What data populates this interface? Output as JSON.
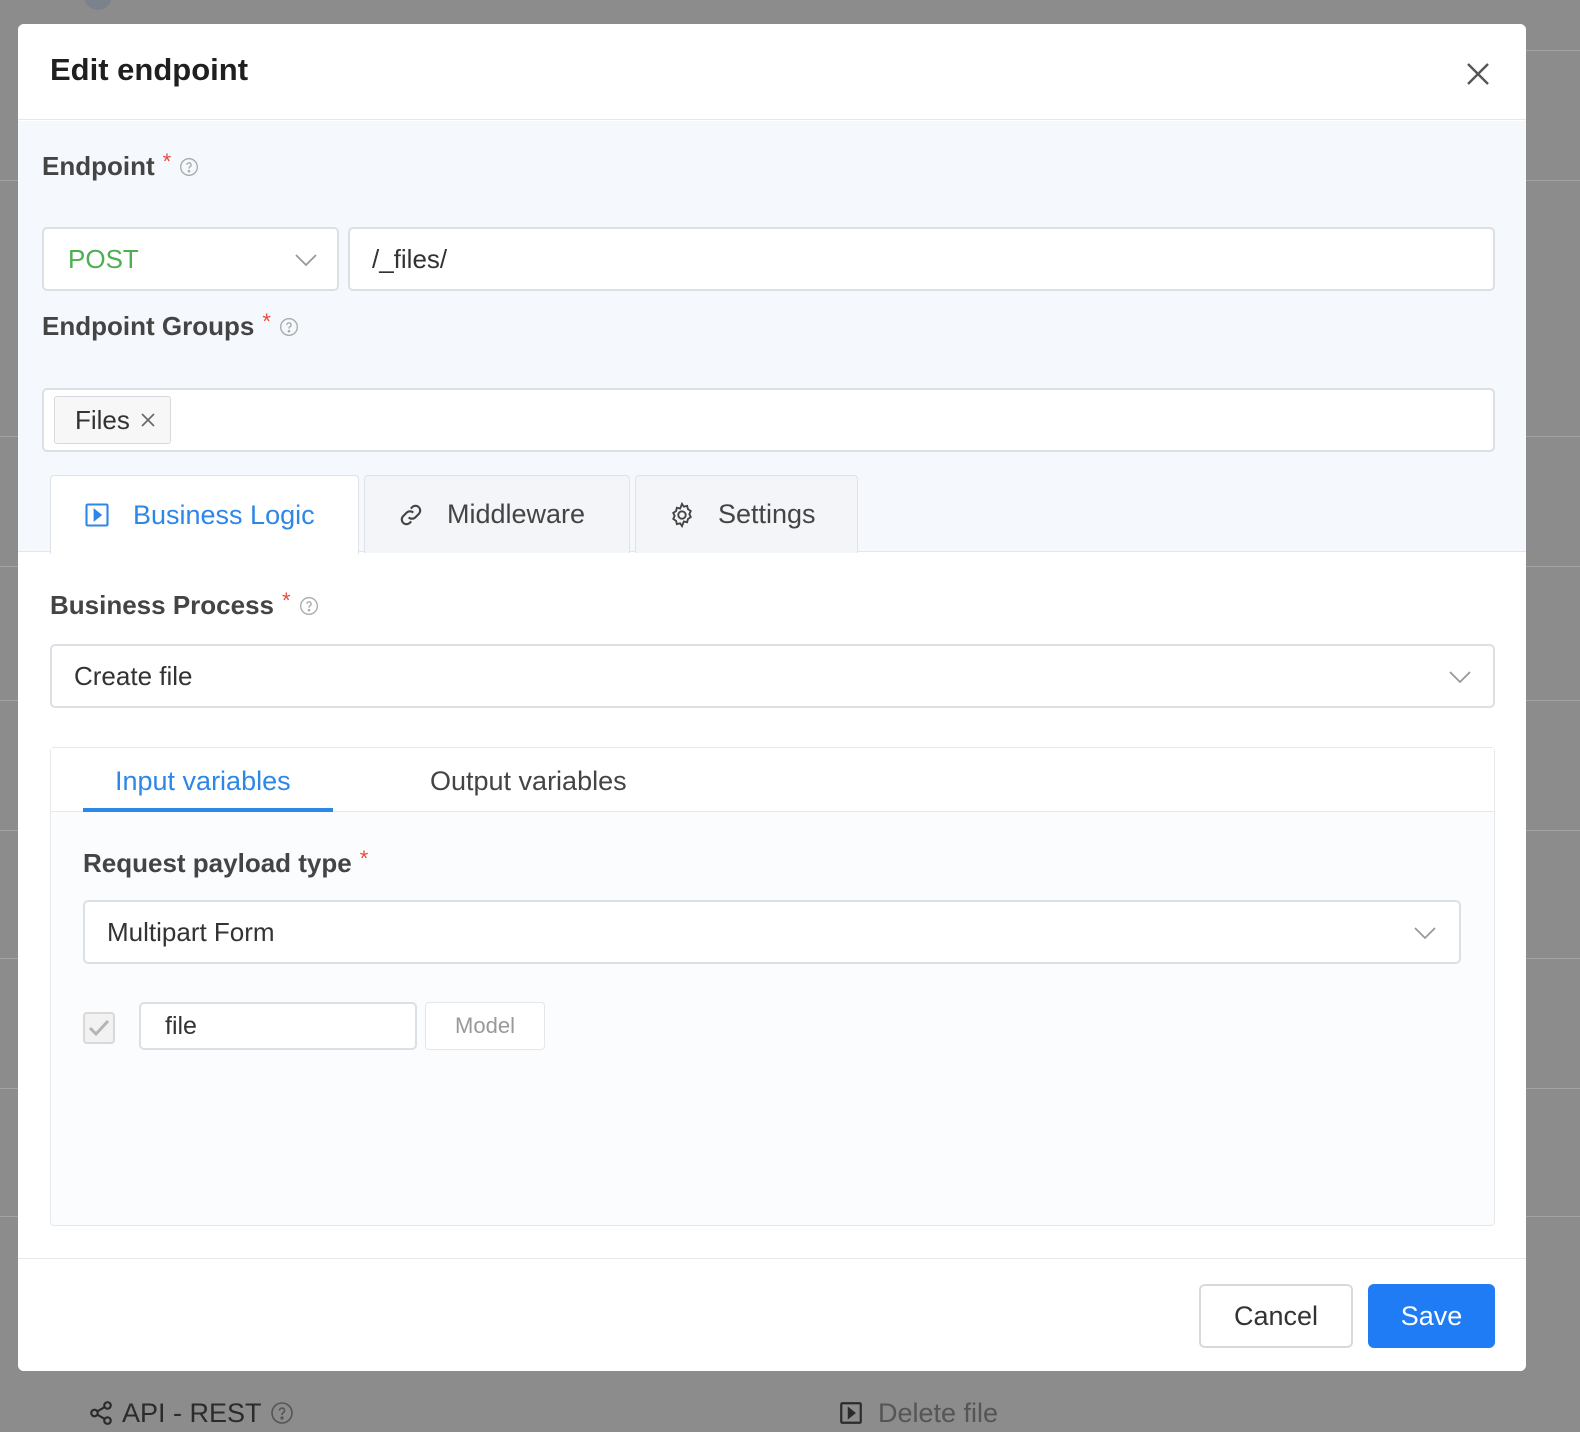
{
  "background": {
    "footer_left_label": "API - REST",
    "footer_right_label": "Delete file"
  },
  "modal": {
    "title": "Edit endpoint",
    "close_icon": "close-icon"
  },
  "endpoint": {
    "label": "Endpoint",
    "required_mark": "*",
    "method": "POST",
    "path": "/_files/"
  },
  "endpoint_groups": {
    "label": "Endpoint Groups",
    "required_mark": "*",
    "tags": [
      "Files"
    ]
  },
  "tabs": [
    {
      "label": "Business Logic",
      "icon": "play-square-icon",
      "active": true
    },
    {
      "label": "Middleware",
      "icon": "link-icon",
      "active": false
    },
    {
      "label": "Settings",
      "icon": "gear-icon",
      "active": false
    }
  ],
  "business_process": {
    "label": "Business Process",
    "required_mark": "*",
    "value": "Create file"
  },
  "variables_tabs": {
    "input_label": "Input variables",
    "output_label": "Output variables"
  },
  "request_payload": {
    "label": "Request payload type",
    "required_mark": "*",
    "value": "Multipart Form"
  },
  "field_row": {
    "name": "file",
    "model_label": "Model",
    "checked": true
  },
  "footer": {
    "cancel_label": "Cancel",
    "save_label": "Save"
  },
  "colors": {
    "accent": "#2d87e6",
    "save_button": "#1f7cf5",
    "method_post": "#4caf50",
    "required": "#e74c3c"
  }
}
